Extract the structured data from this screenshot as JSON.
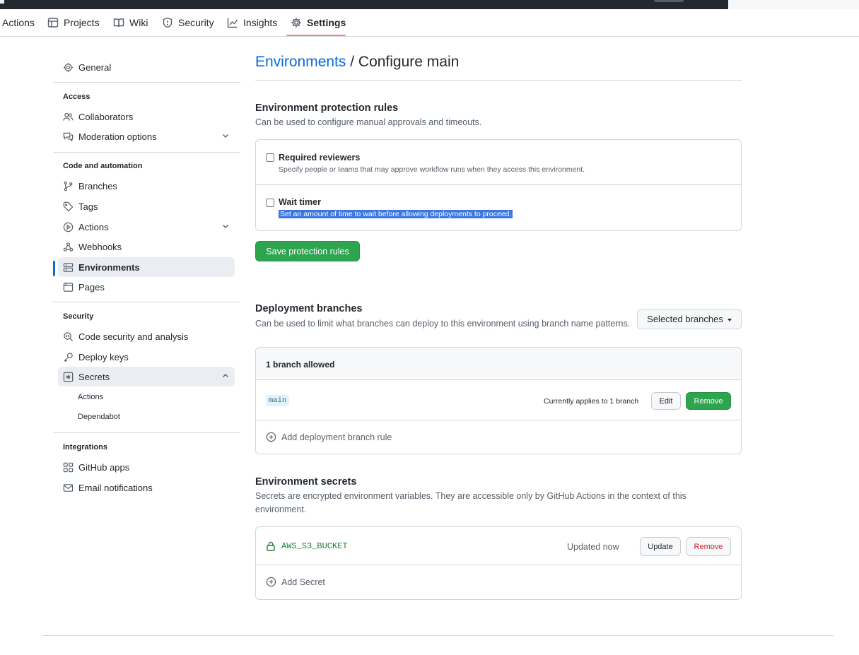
{
  "repo_nav": {
    "tabs": [
      {
        "label": "Actions",
        "icon": "play-icon"
      },
      {
        "label": "Projects",
        "icon": "table-icon"
      },
      {
        "label": "Wiki",
        "icon": "book-icon"
      },
      {
        "label": "Security",
        "icon": "shield-icon"
      },
      {
        "label": "Insights",
        "icon": "graph-icon"
      },
      {
        "label": "Settings",
        "icon": "gear-icon",
        "active": true
      }
    ]
  },
  "sidebar": {
    "general": "General",
    "access_heading": "Access",
    "collaborators": "Collaborators",
    "moderation": "Moderation options",
    "code_heading": "Code and automation",
    "branches": "Branches",
    "tags": "Tags",
    "actions": "Actions",
    "webhooks": "Webhooks",
    "environments": "Environments",
    "pages": "Pages",
    "security_heading": "Security",
    "code_security": "Code security and analysis",
    "deploy_keys": "Deploy keys",
    "secrets": "Secrets",
    "secrets_actions": "Actions",
    "secrets_dependabot": "Dependabot",
    "integrations_heading": "Integrations",
    "github_apps": "GitHub apps",
    "email_notifications": "Email notifications"
  },
  "page": {
    "breadcrumb_link": "Environments",
    "breadcrumb_sep": " / ",
    "title": "Configure main"
  },
  "protection": {
    "title": "Environment protection rules",
    "description": "Can be used to configure manual approvals and timeouts.",
    "rules": [
      {
        "title": "Required reviewers",
        "description": "Specify people or teams that may approve workflow runs when they access this environment.",
        "checked": false
      },
      {
        "title": "Wait timer",
        "description": "Set an amount of time to wait before allowing deployments to proceed.",
        "checked": false
      }
    ],
    "save_label": "Save protection rules"
  },
  "deployment": {
    "title": "Deployment branches",
    "description": "Can be used to limit what branches can deploy to this environment using branch name patterns.",
    "dropdown_label": "Selected branches",
    "header": "1 branch allowed",
    "branch": "main",
    "applies": "Currently applies to 1 branch",
    "edit_label": "Edit",
    "remove_label": "Remove",
    "add_label": "Add deployment branch rule"
  },
  "secrets": {
    "title": "Environment secrets",
    "description": "Secrets are encrypted environment variables. They are accessible only by GitHub Actions in the context of this environment.",
    "name": "AWS_S3_BUCKET",
    "updated": "Updated now",
    "update_label": "Update",
    "remove_label": "Remove",
    "add_label": "Add Secret"
  },
  "colors": {
    "accent": "#0969da",
    "primary_button": "#2da44e",
    "danger": "#cf222e",
    "tab_underline": "#fd8c73",
    "secret_name": "#1a7f37"
  }
}
